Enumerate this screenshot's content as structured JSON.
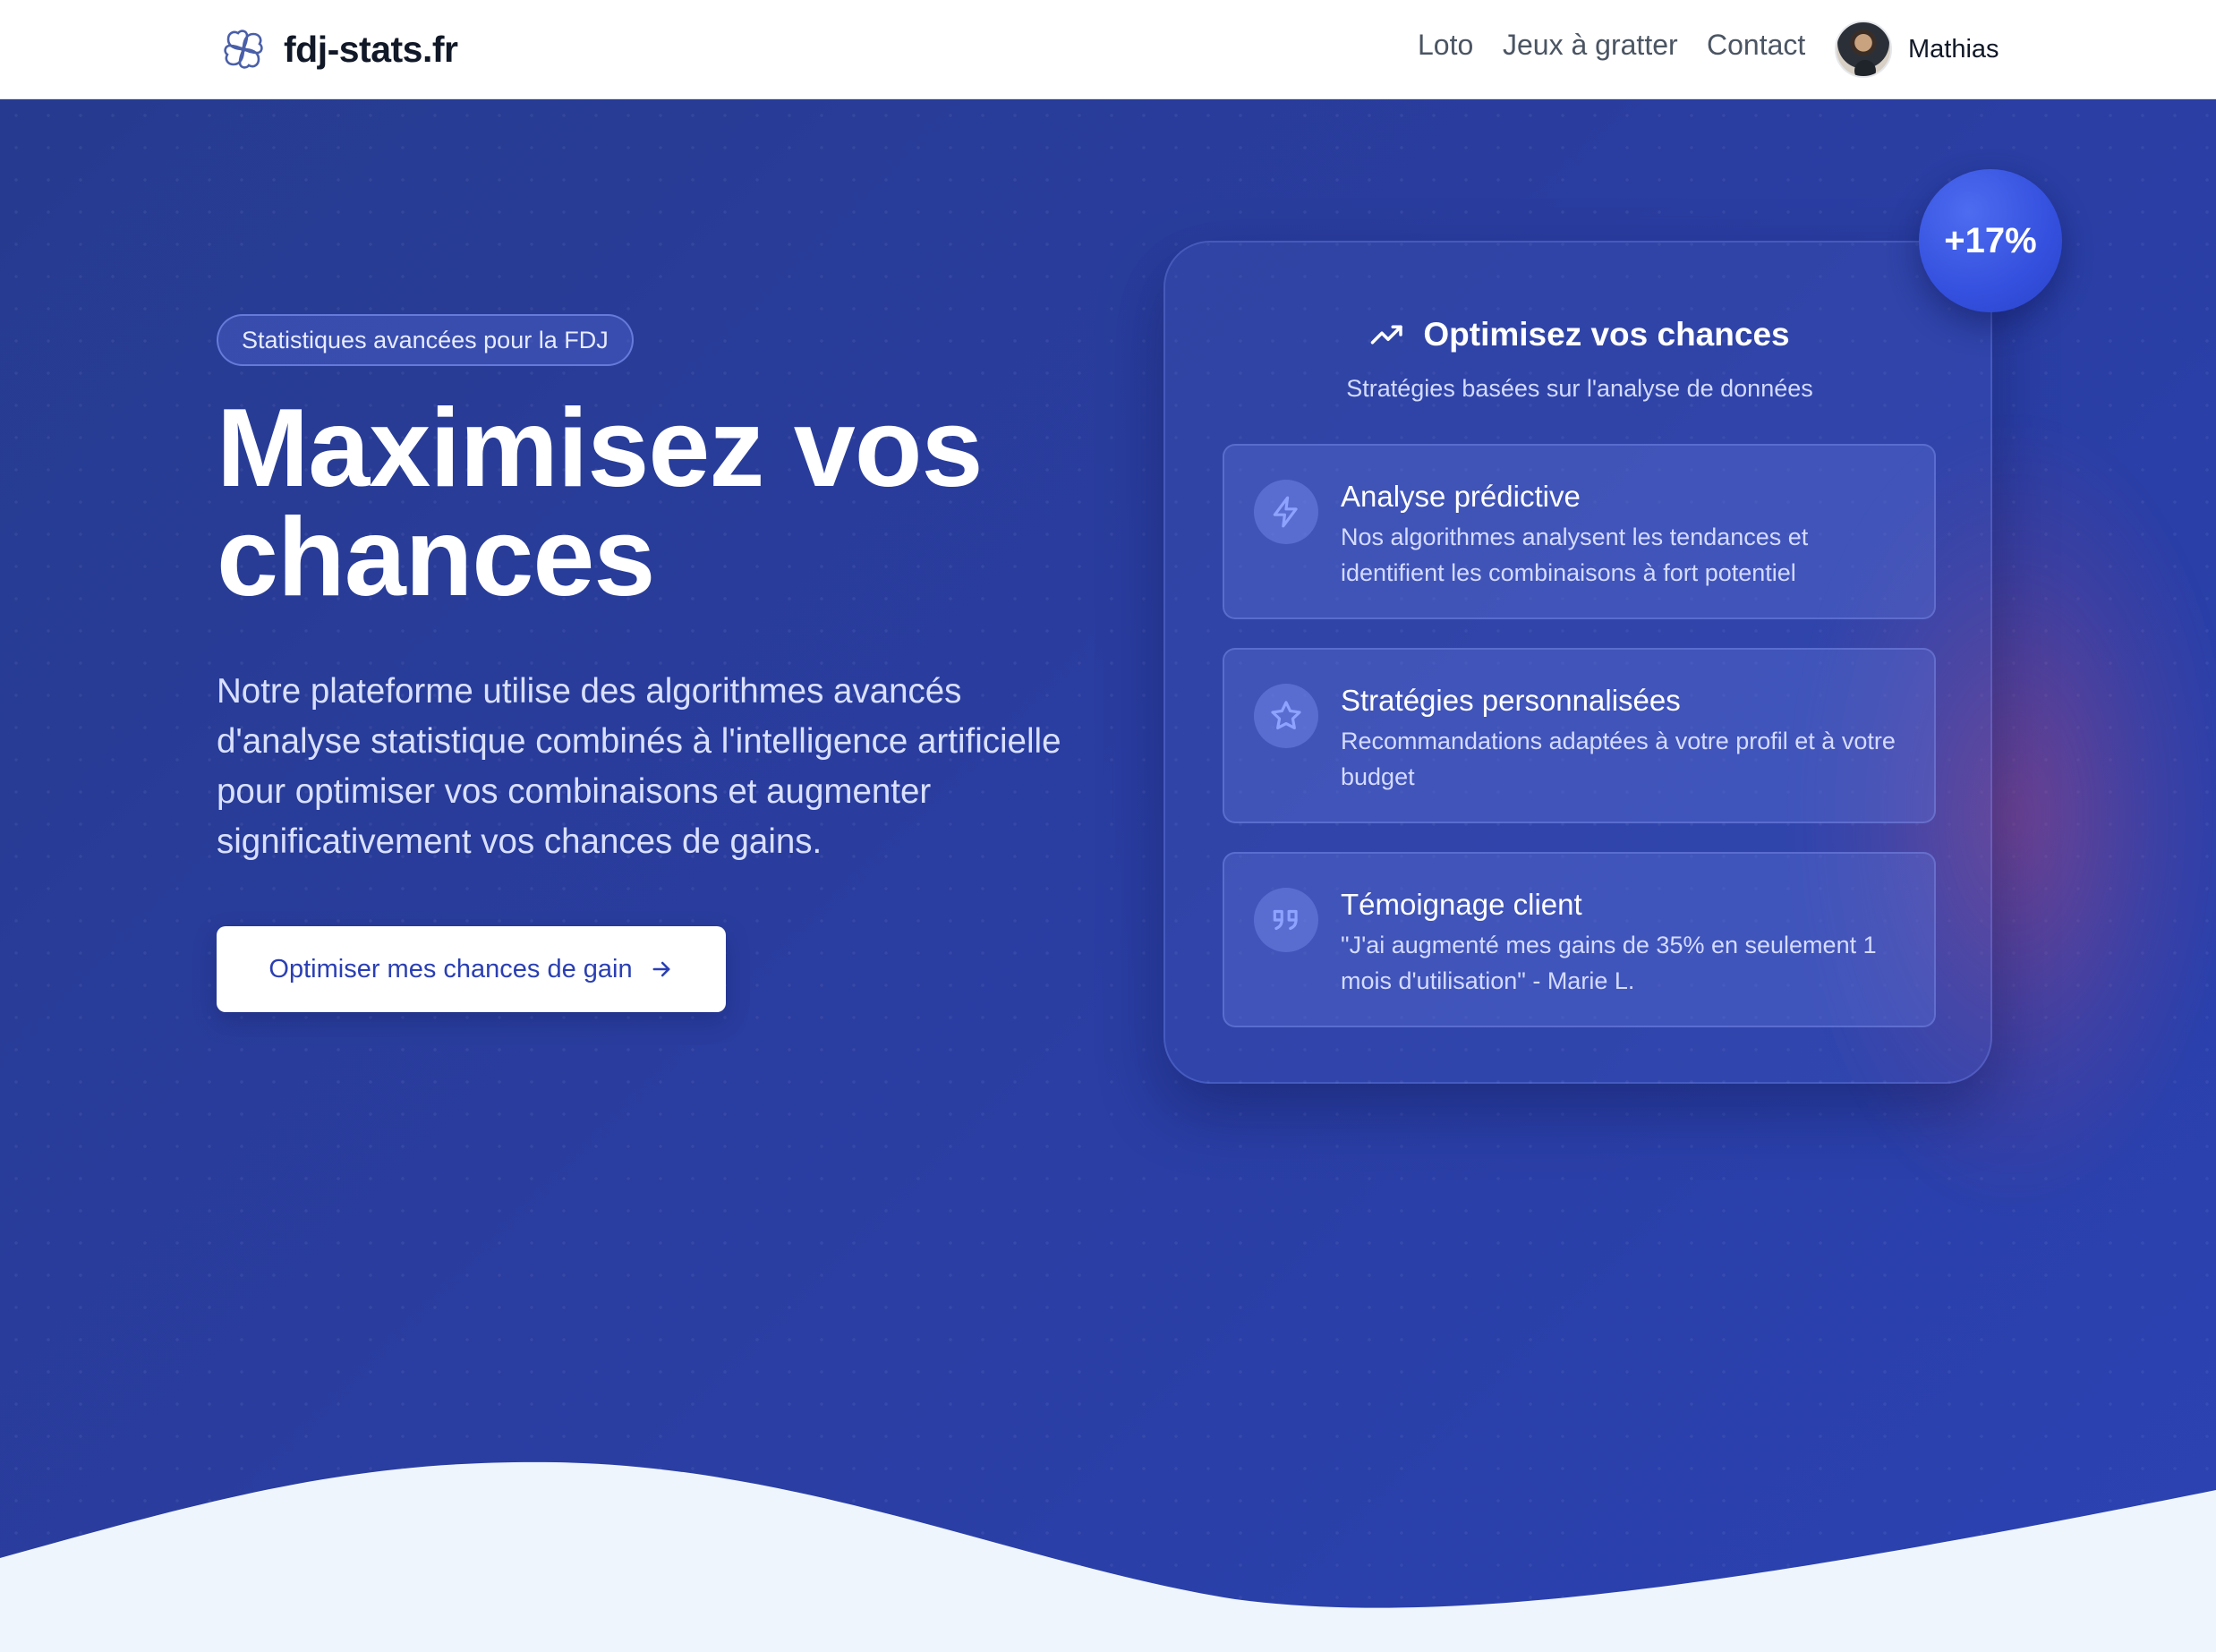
{
  "header": {
    "brand": "fdj-stats.fr",
    "nav": [
      {
        "label": "Loto"
      },
      {
        "label": "Jeux à gratter"
      },
      {
        "label": "Contact"
      }
    ],
    "user": {
      "name": "Mathias"
    }
  },
  "hero": {
    "badge": "Statistiques avancées pour la FDJ",
    "title_line1": "Maximisez vos",
    "title_line2": "chances",
    "description": "Notre plateforme utilise des algorithmes avancés d'analyse statistique combinés à l'intelligence artificielle pour optimiser vos combinaisons et augmenter significativement vos chances de gains.",
    "cta_label": "Optimiser mes chances de gain",
    "cta_icon": "arrow-right-icon"
  },
  "card": {
    "title": "Optimisez vos chances",
    "title_icon": "trending-up-icon",
    "subtitle": "Stratégies basées sur l'analyse de données",
    "percent_badge": "+17%",
    "features": [
      {
        "icon": "lightning-icon",
        "title": "Analyse prédictive",
        "text": "Nos algorithmes analysent les tendances et identifient les combinaisons à fort potentiel"
      },
      {
        "icon": "star-icon",
        "title": "Stratégies personnalisées",
        "text": "Recommandations adaptées à votre profil et à votre budget"
      },
      {
        "icon": "quote-icon",
        "title": "Témoignage client",
        "text": "\"J'ai augmenté mes gains de 35% en seulement 1 mois d'utilisation\" - Marie L."
      }
    ]
  },
  "colors": {
    "hero_bg": "#2a3da0",
    "cta_text": "#2a3fb3",
    "badge_bg": "#3450de",
    "page_bg": "#eef5fd"
  }
}
